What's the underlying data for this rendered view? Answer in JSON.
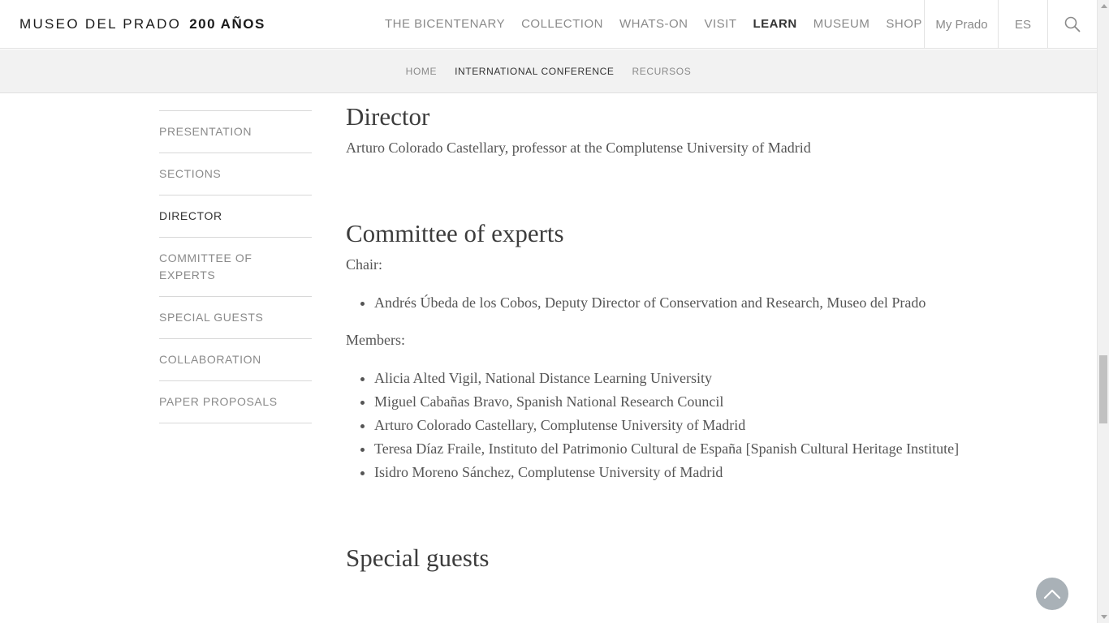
{
  "header": {
    "logo_text": "MUSEO DEL PRADO",
    "logo_years": "200 AÑOS",
    "nav": [
      {
        "label": "THE BICENTENARY",
        "active": false
      },
      {
        "label": "COLLECTION",
        "active": false
      },
      {
        "label": "WHATS-ON",
        "active": false
      },
      {
        "label": "VISIT",
        "active": false
      },
      {
        "label": "LEARN",
        "active": true
      },
      {
        "label": "MUSEUM",
        "active": false
      },
      {
        "label": "SHOP",
        "active": false
      }
    ],
    "my_prado": "My Prado",
    "language": "ES",
    "search_icon": "search-icon"
  },
  "subnav": {
    "items": [
      {
        "label": "HOME",
        "active": false
      },
      {
        "label": "INTERNATIONAL CONFERENCE",
        "active": true
      },
      {
        "label": "RECURSOS",
        "active": false
      }
    ]
  },
  "sidebar": {
    "items": [
      {
        "label": "PRESENTATION",
        "active": false
      },
      {
        "label": "SECTIONS",
        "active": false
      },
      {
        "label": "DIRECTOR",
        "active": true
      },
      {
        "label": "COMMITTEE OF EXPERTS",
        "active": false
      },
      {
        "label": "SPECIAL GUESTS",
        "active": false
      },
      {
        "label": "COLLABORATION",
        "active": false
      },
      {
        "label": "PAPER PROPOSALS",
        "active": false
      }
    ]
  },
  "main": {
    "director": {
      "title": "Director",
      "text": "Arturo Colorado Castellary, professor at the Complutense University of Madrid"
    },
    "committee": {
      "title": "Committee of experts",
      "chair_label": "Chair:",
      "chair": [
        "Andrés Úbeda de los Cobos, Deputy Director of Conservation and Research, Museo del Prado"
      ],
      "members_label": "Members:",
      "members": [
        "Alicia Alted Vigil, National Distance Learning University",
        "Miguel Cabañas Bravo, Spanish National Research Council",
        "Arturo Colorado Castellary, Complutense University of Madrid",
        "Teresa Díaz Fraile, Instituto del Patrimonio Cultural de España [Spanish Cultural Heritage Institute]",
        "Isidro Moreno Sánchez, Complutense University of Madrid"
      ]
    },
    "special_guests": {
      "title": "Special guests"
    }
  },
  "ui": {
    "back_to_top_icon": "chevron-up-icon"
  },
  "colors": {
    "text_muted": "#8a8a8a",
    "text_active": "#333333",
    "subnav_bg": "#f2f2f2",
    "back_to_top_bg": "#a9b1b7"
  }
}
